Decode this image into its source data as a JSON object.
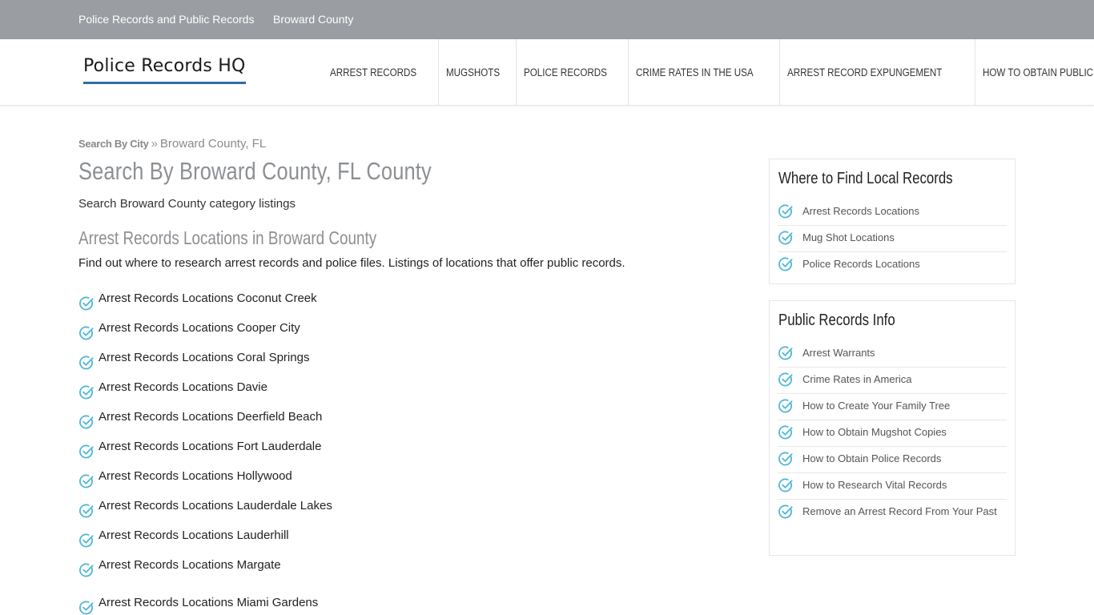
{
  "topbar": {
    "links": [
      "Police Records and Public Records",
      "Broward County"
    ]
  },
  "header": {
    "logo": "Police Records HQ",
    "nav": [
      "ARREST RECORDS",
      "MUGSHOTS",
      "POLICE RECORDS",
      "CRIME RATES IN THE USA",
      "ARREST RECORD EXPUNGEMENT",
      "HOW TO OBTAIN PUBLIC RECORDS"
    ]
  },
  "breadcrumb": {
    "link": "Search By City",
    "separator": "»",
    "current": "Broward County, FL"
  },
  "main": {
    "title": "Search By Broward County, FL County",
    "subtitle": "Search Broward County category listings",
    "section_title": "Arrest Records Locations in Broward County",
    "section_desc": "Find out where to research arrest records and police files. Listings of locations that offer public records.",
    "locations": [
      "Arrest Records Locations Coconut Creek",
      "Arrest Records Locations Cooper City",
      "Arrest Records Locations Coral Springs",
      "Arrest Records Locations Davie",
      "Arrest Records Locations Deerfield Beach",
      "Arrest Records Locations Fort Lauderdale",
      "Arrest Records Locations Hollywood",
      "Arrest Records Locations Lauderdale Lakes",
      "Arrest Records Locations Lauderhill",
      "Arrest Records Locations Margate",
      "Arrest Records Locations Miami Gardens"
    ]
  },
  "sidebar": {
    "local": {
      "title": "Where to Find Local Records",
      "items": [
        "Arrest Records Locations",
        "Mug Shot Locations",
        "Police Records Locations"
      ]
    },
    "info": {
      "title": "Public Records Info",
      "items": [
        "Arrest Warrants",
        "Crime Rates in America",
        "How to Create Your Family Tree",
        "How to Obtain Mugshot Copies",
        "How to Obtain Police Records",
        "How to Research Vital Records",
        "Remove an Arrest Record From Your Past"
      ]
    }
  },
  "colors": {
    "topbar": "#9a9da1",
    "check_icon": "#4fb7d6",
    "logo_underline": "#2e6da4",
    "muted_heading": "#8c8f93"
  },
  "icons": {
    "list_bullet": "check-circle-icon"
  }
}
